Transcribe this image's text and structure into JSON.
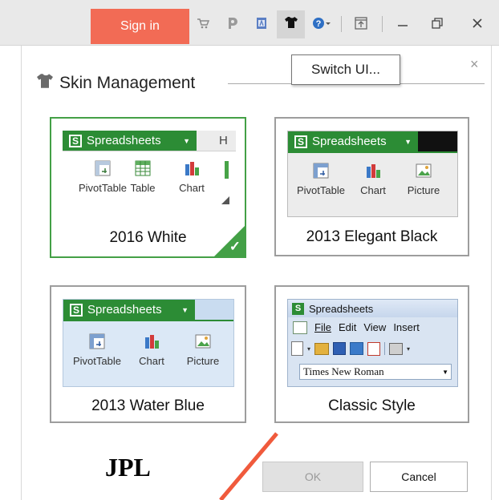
{
  "toolbar": {
    "signin_label": "Sign in",
    "accent": "#f26b55",
    "icons": [
      "cart-icon",
      "badge-icon",
      "document-icon",
      "shirt-icon",
      "help-icon"
    ],
    "window_controls": [
      "pin-icon",
      "minimize-icon",
      "restore-icon",
      "close-icon"
    ]
  },
  "tooltip": {
    "text": "Switch UI..."
  },
  "dialog": {
    "title": "Skin Management",
    "close_glyph": "×",
    "ok_label": "OK",
    "cancel_label": "Cancel",
    "selected_color": "#43a046"
  },
  "skins": [
    {
      "name": "2016 White",
      "selected": true,
      "header": "Spreadsheets",
      "tab": "H",
      "buttons": [
        "PivotTable",
        "Table",
        "Chart"
      ]
    },
    {
      "name": "2013 Elegant Black",
      "selected": false,
      "header": "Spreadsheets",
      "buttons": [
        "PivotTable",
        "Chart",
        "Picture"
      ]
    },
    {
      "name": "2013 Water Blue",
      "selected": false,
      "header": "Spreadsheets",
      "buttons": [
        "PivotTable",
        "Chart",
        "Picture"
      ]
    },
    {
      "name": "Classic Style",
      "selected": false,
      "header": "Spreadsheets",
      "menu": [
        "File",
        "Edit",
        "View",
        "Insert"
      ],
      "font": "Times New Roman"
    }
  ],
  "watermark": "JPL"
}
